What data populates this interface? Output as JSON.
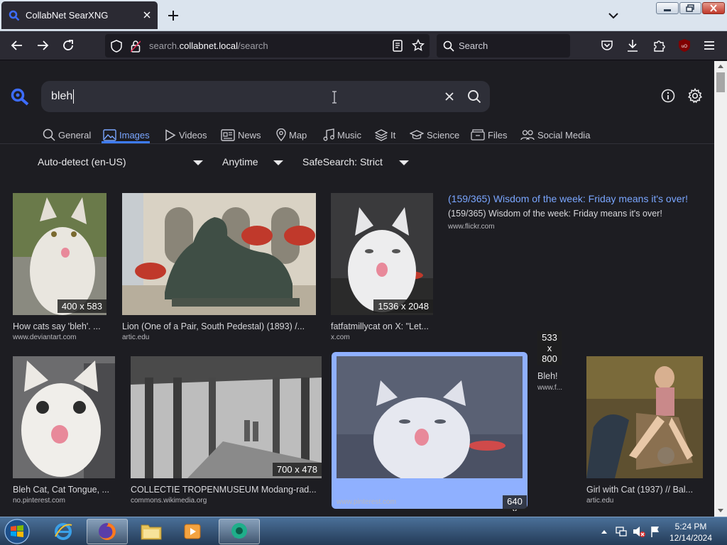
{
  "browser": {
    "tab_title": "CollabNet SearXNG",
    "url_plain_prefix": "search.",
    "url_domain": "collabnet.local",
    "url_path": "/search",
    "search_placeholder": "Search"
  },
  "search": {
    "query": "bleh"
  },
  "categories": [
    {
      "label": "General",
      "icon": "search-icon"
    },
    {
      "label": "Images",
      "icon": "image-icon"
    },
    {
      "label": "Videos",
      "icon": "play-icon"
    },
    {
      "label": "News",
      "icon": "newspaper-icon"
    },
    {
      "label": "Map",
      "icon": "map-pin-icon"
    },
    {
      "label": "Music",
      "icon": "music-icon"
    },
    {
      "label": "It",
      "icon": "layers-icon"
    },
    {
      "label": "Science",
      "icon": "graduation-cap-icon"
    },
    {
      "label": "Files",
      "icon": "file-box-icon"
    },
    {
      "label": "Social Media",
      "icon": "users-icon"
    }
  ],
  "filters": {
    "language": "Auto-detect (en-US)",
    "time": "Anytime",
    "safesearch": "SafeSearch: Strict"
  },
  "results": [
    {
      "caption": "How cats say 'bleh'. ...",
      "source": "www.deviantart.com",
      "resolution": "400 x 583"
    },
    {
      "caption": "Lion (One of a Pair, South Pedestal) (1893) /...",
      "source": "artic.edu",
      "resolution": ""
    },
    {
      "caption": "fatfatmillycat on X: \"Let...",
      "source": "x.com",
      "resolution": "1536 x 2048"
    },
    {
      "caption": "(159/365) Wisdom of the week: Friday means it's over!",
      "title_link": "(159/365) Wisdom of the week: Friday means it's over!",
      "source": "www.flickr.com"
    },
    {
      "caption": "Bleh Cat, Cat Tongue, ...",
      "source": "no.pinterest.com",
      "resolution": ""
    },
    {
      "caption": "COLLECTIE TROPENMUSEUM Modang-rad...",
      "source": "commons.wikimedia.org",
      "resolution": "700 x 478"
    },
    {
      "caption": "",
      "source": "www.pinterest.com",
      "resolution": "640 x"
    },
    {
      "caption": "Bleh!",
      "source": "www.f...",
      "resolution": "533 x 800"
    },
    {
      "caption": "Girl with Cat (1937) // Bal...",
      "source": "artic.edu",
      "resolution": ""
    }
  ],
  "taskbar": {
    "time": "5:24 PM",
    "date": "12/14/2024"
  },
  "colors": {
    "accent": "#3d7cff",
    "link": "#7aa6ff",
    "selected_card": "#8fb0ff"
  }
}
